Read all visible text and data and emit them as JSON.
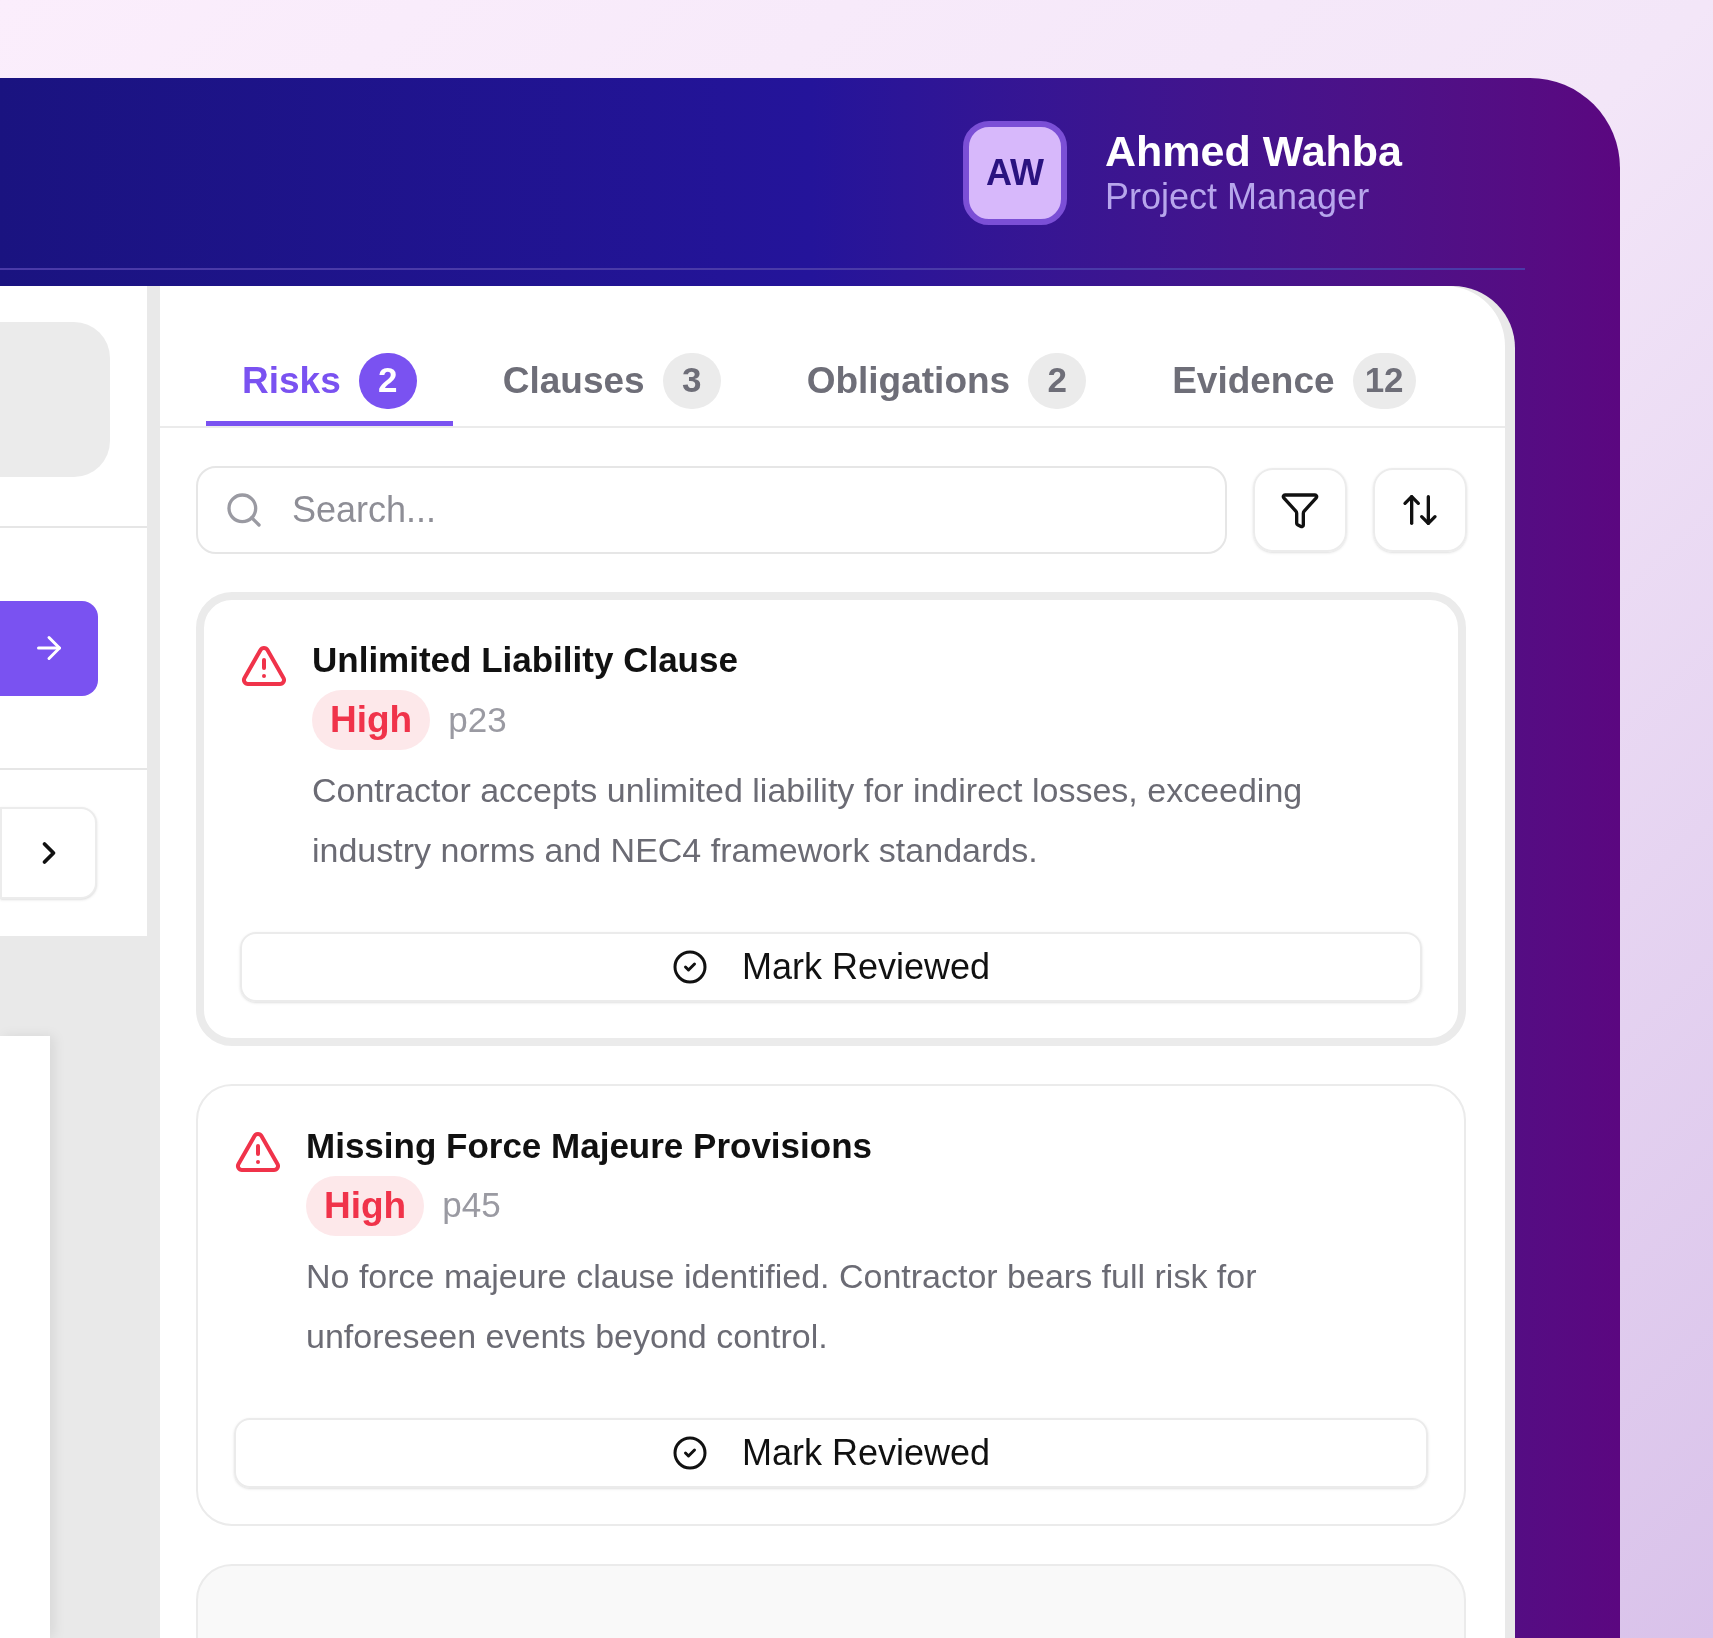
{
  "user": {
    "initials": "AW",
    "name": "Ahmed Wahba",
    "role": "Project Manager"
  },
  "tabs": [
    {
      "label": "Risks",
      "count": "2",
      "selected": true
    },
    {
      "label": "Clauses",
      "count": "3",
      "selected": false
    },
    {
      "label": "Obligations",
      "count": "2",
      "selected": false
    },
    {
      "label": "Evidence",
      "count": "12",
      "selected": false
    }
  ],
  "search": {
    "placeholder": "Search..."
  },
  "risks": [
    {
      "title": "Unlimited Liability Clause",
      "severity": "High",
      "kind": "high",
      "page": "p23",
      "description": "Contractor accepts unlimited liability for indirect losses, exceeding industry norms and NEC4 framework standards.",
      "action": "Mark Reviewed",
      "highlighted": true
    },
    {
      "title": "Missing Force Majeure Provisions",
      "severity": "High",
      "kind": "high",
      "page": "p45",
      "description": "No force majeure clause identified. Contractor bears full risk for unforeseen events beyond control.",
      "action": "Mark Reviewed",
      "highlighted": false
    }
  ]
}
